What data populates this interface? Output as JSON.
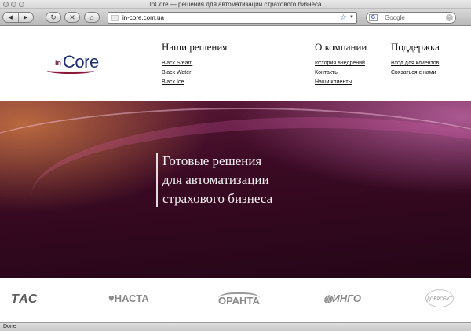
{
  "window": {
    "title": "InCore — решения для автоматизации страхового бизнеса",
    "status": "Done"
  },
  "toolbar": {
    "back_icon": "back-arrow-icon",
    "forward_icon": "forward-arrow-icon",
    "reload_icon": "reload-icon",
    "stop_icon": "stop-icon",
    "home_icon": "home-icon",
    "url": "in-core.com.ua",
    "search_placeholder": "Google"
  },
  "logo": {
    "prefix": "in",
    "name": "Core"
  },
  "nav": {
    "solutions": {
      "title": "Наши решения",
      "links": [
        "Black Steam",
        "Black Water",
        "Black Ice"
      ]
    },
    "company": {
      "title": "О компании",
      "links": [
        "История внедрений",
        "Контакты",
        "Наши клиенты"
      ]
    },
    "support": {
      "title": "Поддержка",
      "links": [
        "Вход для клиентов",
        "Связаться с нами"
      ]
    }
  },
  "hero": {
    "line1": "Готовые решения",
    "line2": "для автоматизации",
    "line3": "страхового бизнеса"
  },
  "partners": [
    "ТАС",
    "НАСТА",
    "ОРАНТА",
    "ИНГО",
    "ДОБРОБУТ"
  ],
  "colors": {
    "hero_dark": "#3b0a24",
    "hero_accent": "#c0407a",
    "logo_blue": "#1f2f6f"
  }
}
